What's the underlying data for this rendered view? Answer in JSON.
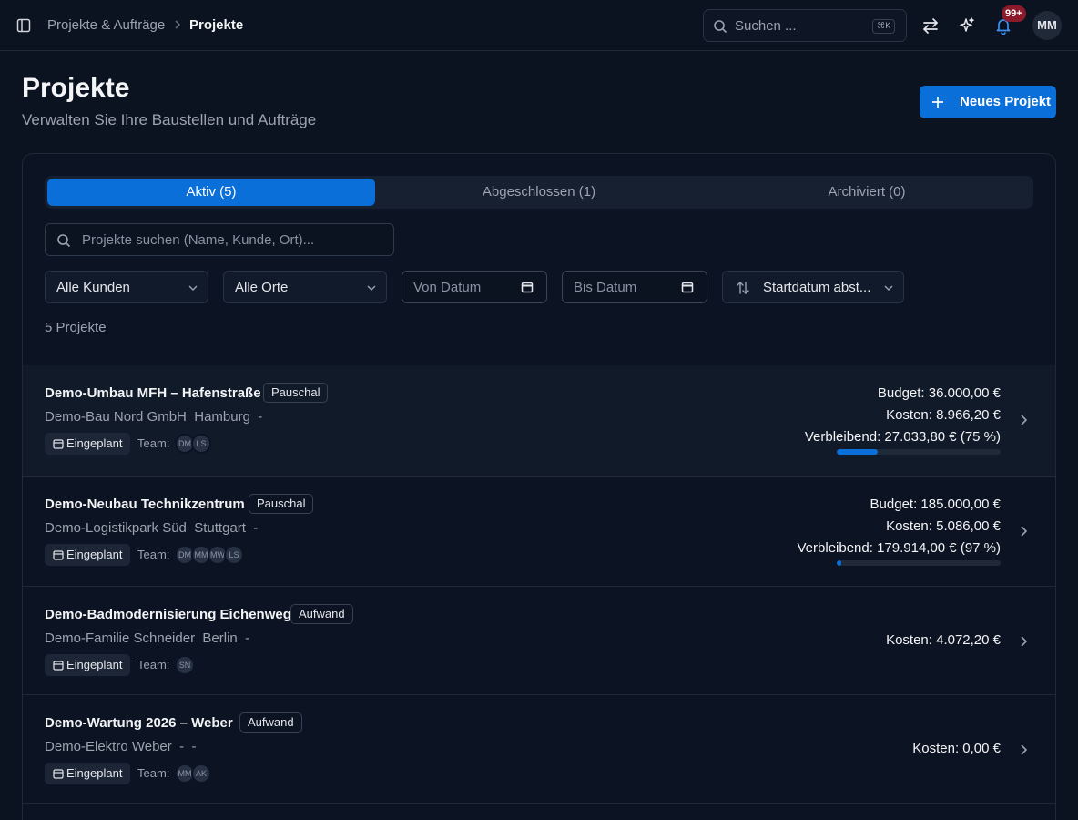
{
  "topbar": {
    "breadcrumb": [
      "Projekte & Aufträge",
      "Projekte"
    ],
    "search_placeholder": "Suchen ...",
    "search_shortcut": "⌘K",
    "notification_badge": "99+",
    "user_initials": "MM"
  },
  "header": {
    "title": "Projekte",
    "subtitle": "Verwalten Sie Ihre Baustellen und Aufträge",
    "new_button": "Neues Projekt"
  },
  "tabs": [
    {
      "label": "Aktiv (5)",
      "active": true
    },
    {
      "label": "Abgeschlossen (1)",
      "active": false
    },
    {
      "label": "Archiviert (0)",
      "active": false
    }
  ],
  "filters": {
    "search_placeholder": "Projekte suchen (Name, Kunde, Ort)...",
    "customer": "Alle Kunden",
    "location": "Alle Orte",
    "from_date": "Von Datum",
    "to_date": "Bis Datum",
    "sort": "Startdatum abst..."
  },
  "count_label": "5 Projekte",
  "team_label": "Team:",
  "projects": [
    {
      "name": "Demo-Umbau MFH – Hafenstraße",
      "type": "Pauschal",
      "customer": "Demo-Bau Nord GmbH",
      "city": "Hamburg",
      "extra": "-",
      "status": "Eingeplant",
      "team": [
        "DM",
        "LS"
      ],
      "budget": "Budget: 36.000,00 €",
      "costs": "Kosten: 8.966,20 €",
      "remaining": "Verbleibend: 27.033,80 € (75 %)",
      "spent_fraction": 0.25
    },
    {
      "name": "Demo-Neubau Technikzentrum",
      "type": "Pauschal",
      "customer": "Demo-Logistikpark Süd",
      "city": "Stuttgart",
      "extra": "-",
      "status": "Eingeplant",
      "team": [
        "DM",
        "MM",
        "MW",
        "LS"
      ],
      "budget": "Budget: 185.000,00 €",
      "costs": "Kosten: 5.086,00 €",
      "remaining": "Verbleibend: 179.914,00 € (97 %)",
      "spent_fraction": 0.03
    },
    {
      "name": "Demo-Badmodernisierung Eichenweg",
      "type": "Aufwand",
      "customer": "Demo-Familie Schneider",
      "city": "Berlin",
      "extra": "-",
      "status": "Eingeplant",
      "team": [
        "SN"
      ],
      "costs": "Kosten: 4.072,20 €"
    },
    {
      "name": "Demo-Wartung 2026 – Weber",
      "type": "Aufwand",
      "customer": "Demo-Elektro Weber",
      "city": "-",
      "extra": "-",
      "status": "Eingeplant",
      "team": [
        "MM",
        "AK"
      ],
      "costs": "Kosten: 0,00 €"
    }
  ],
  "colors": {
    "background": "#0b1220",
    "accent": "#0a6fd8",
    "badge": "#8b1a2b"
  }
}
